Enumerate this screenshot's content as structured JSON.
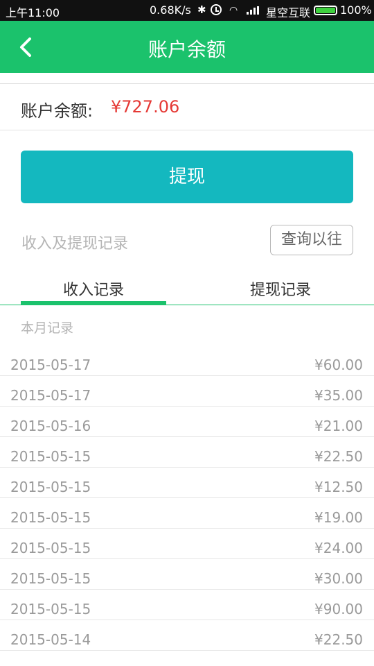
{
  "status_bar": {
    "time": "上午11:00",
    "speed": "0.68K/s",
    "carrier": "星空互联",
    "battery": "100%",
    "battery_level": 1.0,
    "icons": [
      "bluetooth-icon",
      "alarm-icon",
      "wifi-icon",
      "signal-icon",
      "battery-icon"
    ]
  },
  "header": {
    "title": "账户余额",
    "back_icon": "chevron-left-icon"
  },
  "balance": {
    "label": "账户余额:",
    "amount": "¥727.06"
  },
  "withdraw_button": {
    "label": "提现"
  },
  "records_section": {
    "label": "收入及提现记录",
    "history_button": "查询以往"
  },
  "tabs": [
    {
      "label": "收入记录",
      "active": true
    },
    {
      "label": "提现记录",
      "active": false
    }
  ],
  "month_label": "本月记录",
  "records": [
    {
      "date": "2015-05-17",
      "amount": "¥60.00"
    },
    {
      "date": "2015-05-17",
      "amount": "¥35.00"
    },
    {
      "date": "2015-05-16",
      "amount": "¥21.00"
    },
    {
      "date": "2015-05-15",
      "amount": "¥22.50"
    },
    {
      "date": "2015-05-15",
      "amount": "¥12.50"
    },
    {
      "date": "2015-05-15",
      "amount": "¥19.00"
    },
    {
      "date": "2015-05-15",
      "amount": "¥24.00"
    },
    {
      "date": "2015-05-15",
      "amount": "¥30.00"
    },
    {
      "date": "2015-05-15",
      "amount": "¥90.00"
    },
    {
      "date": "2015-05-14",
      "amount": "¥22.50"
    }
  ],
  "colors": {
    "primary_green": "#1bc26c",
    "button_teal": "#14b8bf",
    "balance_red": "#e53935"
  }
}
